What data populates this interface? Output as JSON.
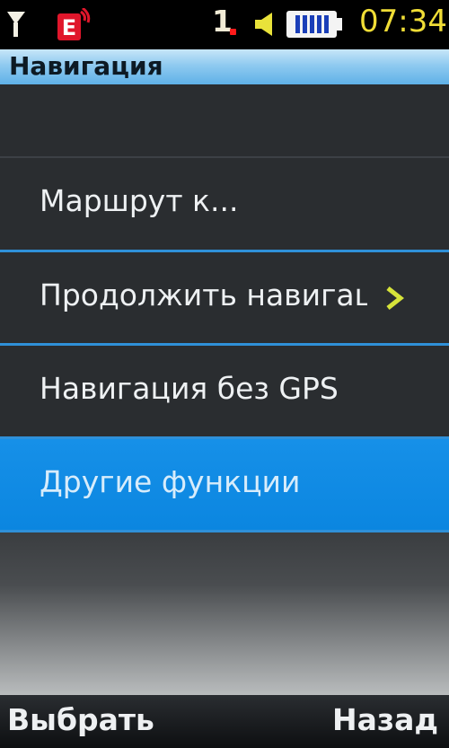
{
  "status_bar": {
    "signal_icon": "antenna-signal-icon",
    "network_icon": "edge-data-icon",
    "network_label": "E",
    "sim_indicator": "1",
    "speaker_icon": "speaker-icon",
    "battery_icon": "battery-icon",
    "time": "07:34"
  },
  "title_bar": {
    "title": "Навигация"
  },
  "menu": {
    "items": [
      {
        "label": "Маршрут к...",
        "has_submenu": false,
        "selected": false
      },
      {
        "label": "Продолжить навигац",
        "has_submenu": true,
        "selected": false
      },
      {
        "label": "Навигация без GPS",
        "has_submenu": false,
        "selected": false
      },
      {
        "label": "Другие функции",
        "has_submenu": false,
        "selected": true
      }
    ]
  },
  "softkeys": {
    "left": "Выбрать",
    "right": "Назад"
  },
  "colors": {
    "accent": "#0b86e0",
    "title_bar": "#8fcaf0",
    "clock": "#f0dd36",
    "chevron": "#d6e33a"
  }
}
